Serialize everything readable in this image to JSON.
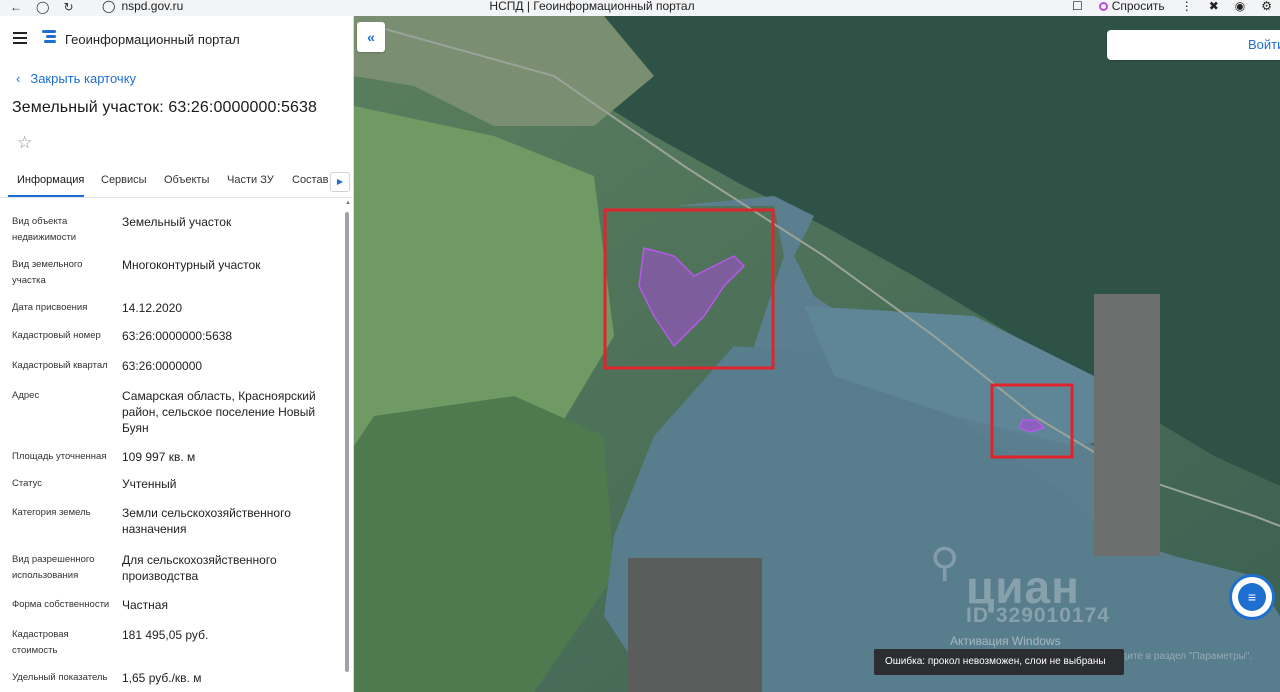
{
  "browser": {
    "url": "nspd.gov.ru",
    "tab_title": "НСПД | Геоинформационный портал",
    "ask_label": "Спросить"
  },
  "sidebar": {
    "portal_title": "Геоинформационный портал",
    "close_card": "Закрыть карточку",
    "card_title": "Земельный участок: 63:26:0000000:5638",
    "tabs": [
      {
        "label": "Информация",
        "active": true
      },
      {
        "label": "Сервисы"
      },
      {
        "label": "Объекты"
      },
      {
        "label": "Части ЗУ"
      },
      {
        "label": "Состав"
      }
    ],
    "attributes": [
      {
        "key": "Вид объекта недвижимости",
        "value": "Земельный участок"
      },
      {
        "key": "Вид земельного участка",
        "value": "Многоконтурный участок"
      },
      {
        "key": "Дата присвоения",
        "value": "14.12.2020"
      },
      {
        "key": "Кадастровый номер",
        "value": "63:26:0000000:5638"
      },
      {
        "key": "Кадастровый квартал",
        "value": "63:26:0000000"
      },
      {
        "key": "Адрес",
        "value": "Самарская область, Красноярский район, сельское поселение Новый Буян"
      },
      {
        "key": "Площадь уточненная",
        "value": "109 997 кв. м"
      },
      {
        "key": "Статус",
        "value": "Учтенный"
      },
      {
        "key": "Категория земель",
        "value": "Земли сельскохозяйственного назначения"
      },
      {
        "key": "Вид разрешенного использования",
        "value": "Для сельскохозяйственного производства"
      },
      {
        "key": "Форма собственности",
        "value": "Частная"
      },
      {
        "key": "Кадастровая стоимость",
        "value": "181 495,05 руб."
      },
      {
        "key": "Удельный показатель",
        "value": "1,65 руб./кв. м"
      }
    ]
  },
  "map": {
    "login_label": "Войти",
    "error_message": "Ошибка: прокол невозможен, слои не выбраны",
    "watermark_brand": "циан",
    "watermark_id": "ID 329010174",
    "windows_activation": "Активация Windows",
    "windows_activation_sub": "Чтобы активировать Windows, перейдите в раздел \"Параметры\".",
    "colors": {
      "highlight_frame": "#e0242d",
      "parcel_fill": "#a64ad6",
      "accent": "#1f6fd1"
    }
  }
}
